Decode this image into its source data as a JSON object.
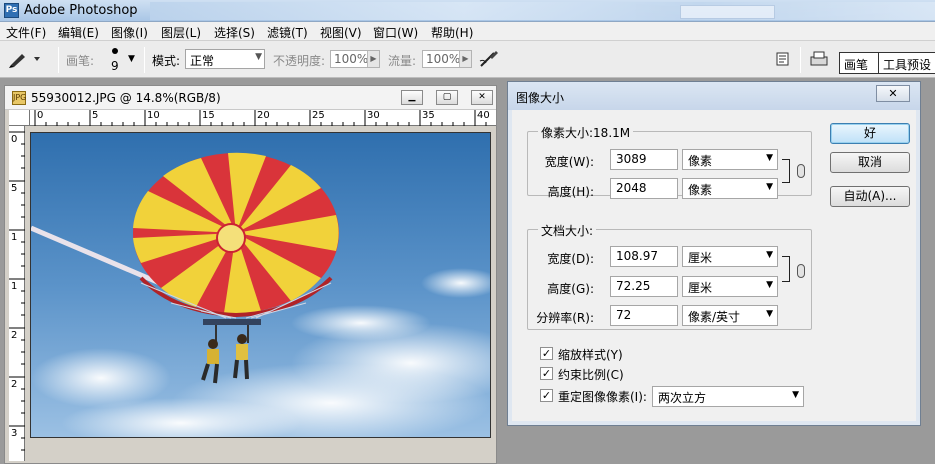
{
  "app": {
    "title": "Adobe Photoshop",
    "icon": "photoshop-app-icon"
  },
  "menu": [
    "文件(F)",
    "编辑(E)",
    "图像(I)",
    "图层(L)",
    "选择(S)",
    "滤镜(T)",
    "视图(V)",
    "窗口(W)",
    "帮助(H)"
  ],
  "options": {
    "brush_label": "画笔:",
    "brush_size": "9",
    "mode_label": "模式:",
    "mode_value": "正常",
    "opacity_label": "不透明度:",
    "opacity_value": "100%",
    "flow_label": "流量:",
    "flow_value": "100%",
    "tab_brushes": "画笔",
    "tab_tool_presets": "工具预设"
  },
  "document": {
    "title": "55930012.JPG @ 14.8%(RGB/8)",
    "ruler_top": [
      "0",
      "5",
      "10",
      "15",
      "20",
      "25",
      "30",
      "35",
      "40"
    ],
    "ruler_left": [
      "0",
      "5",
      "1",
      "1",
      "2",
      "2",
      "3"
    ]
  },
  "dialog": {
    "title": "图像大小",
    "close": "✕",
    "pixel_dims_legend": "像素大小:18.1M",
    "width_label": "宽度(W):",
    "width_value": "3089",
    "width_unit": "像素",
    "height_label": "高度(H):",
    "height_value": "2048",
    "height_unit": "像素",
    "doc_size_legend": "文档大小:",
    "doc_width_label": "宽度(D):",
    "doc_width_value": "108.97",
    "doc_width_unit": "厘米",
    "doc_height_label": "高度(G):",
    "doc_height_value": "72.25",
    "doc_height_unit": "厘米",
    "resolution_label": "分辨率(R):",
    "resolution_value": "72",
    "resolution_unit": "像素/英寸",
    "scale_styles": "缩放样式(Y)",
    "constrain": "约束比例(C)",
    "resample": "重定图像像素(I):",
    "resample_method": "两次立方",
    "ok": "好",
    "cancel": "取消",
    "auto": "自动(A)..."
  }
}
